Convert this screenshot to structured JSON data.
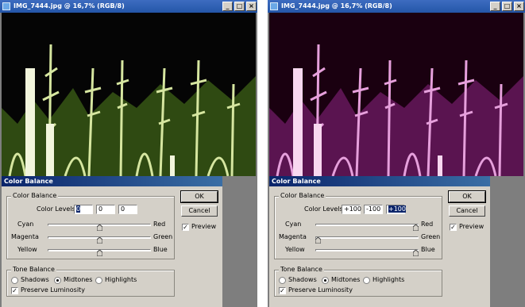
{
  "panels": [
    {
      "window_title": "IMG_7444.jpg @ 16,7% (RGB/8)",
      "tint": "original",
      "colors": {
        "sky": "#050505",
        "foliage_dark": "#2f4a12",
        "foliage_light": "#d6e6a0",
        "flower": "#f2f5dc"
      },
      "dialog": {
        "title": "Color Balance",
        "color_balance_group": "Color Balance",
        "color_levels_label": "Color Levels:",
        "levels": [
          "0",
          "0",
          "0"
        ],
        "selected_level": 0,
        "sliders": [
          {
            "left": "Cyan",
            "right": "Red",
            "value": 0
          },
          {
            "left": "Magenta",
            "right": "Green",
            "value": 0
          },
          {
            "left": "Yellow",
            "right": "Blue",
            "value": 0
          }
        ],
        "tone_balance_group": "Tone Balance",
        "tones": [
          "Shadows",
          "Midtones",
          "Highlights"
        ],
        "selected_tone": "Midtones",
        "preserve_luminosity_label": "Preserve Luminosity",
        "preserve_luminosity": true,
        "ok_label": "OK",
        "cancel_label": "Cancel",
        "preview_label": "Preview",
        "preview": true
      }
    },
    {
      "window_title": "IMG_7444.jpg @ 16,7% (RGB/8)",
      "tint": "magenta",
      "colors": {
        "sky": "#1a0010",
        "foliage_dark": "#5a1450",
        "foliage_light": "#e6a0dc",
        "flower": "#f8d8f0"
      },
      "dialog": {
        "title": "Color Balance",
        "color_balance_group": "Color Balance",
        "color_levels_label": "Color Levels:",
        "levels": [
          "+100",
          "-100",
          "+100"
        ],
        "selected_level": 2,
        "sliders": [
          {
            "left": "Cyan",
            "right": "Red",
            "value": 100
          },
          {
            "left": "Magenta",
            "right": "Green",
            "value": -100
          },
          {
            "left": "Yellow",
            "right": "Blue",
            "value": 100
          }
        ],
        "tone_balance_group": "Tone Balance",
        "tones": [
          "Shadows",
          "Midtones",
          "Highlights"
        ],
        "selected_tone": "Midtones",
        "preserve_luminosity_label": "Preserve Luminosity",
        "preserve_luminosity": true,
        "ok_label": "OK",
        "cancel_label": "Cancel",
        "preview_label": "Preview",
        "preview": true
      }
    }
  ],
  "icons": {
    "minimize": "minimize-icon",
    "maximize": "maximize-icon",
    "close": "close-icon",
    "checkmark": "check-icon"
  }
}
